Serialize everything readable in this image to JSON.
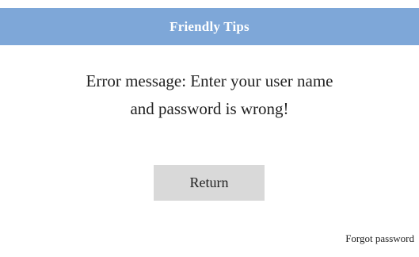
{
  "dialog": {
    "title": "Friendly Tips",
    "message_line_1": "Error message: Enter your user name",
    "message_line_2": "and password is wrong!",
    "return_label": "Return",
    "forgot_label": "Forgot password"
  },
  "colors": {
    "title_bar": "#7ea7d8",
    "title_text": "#ffffff",
    "button_bg": "#d9d9d9",
    "text": "#222222"
  }
}
